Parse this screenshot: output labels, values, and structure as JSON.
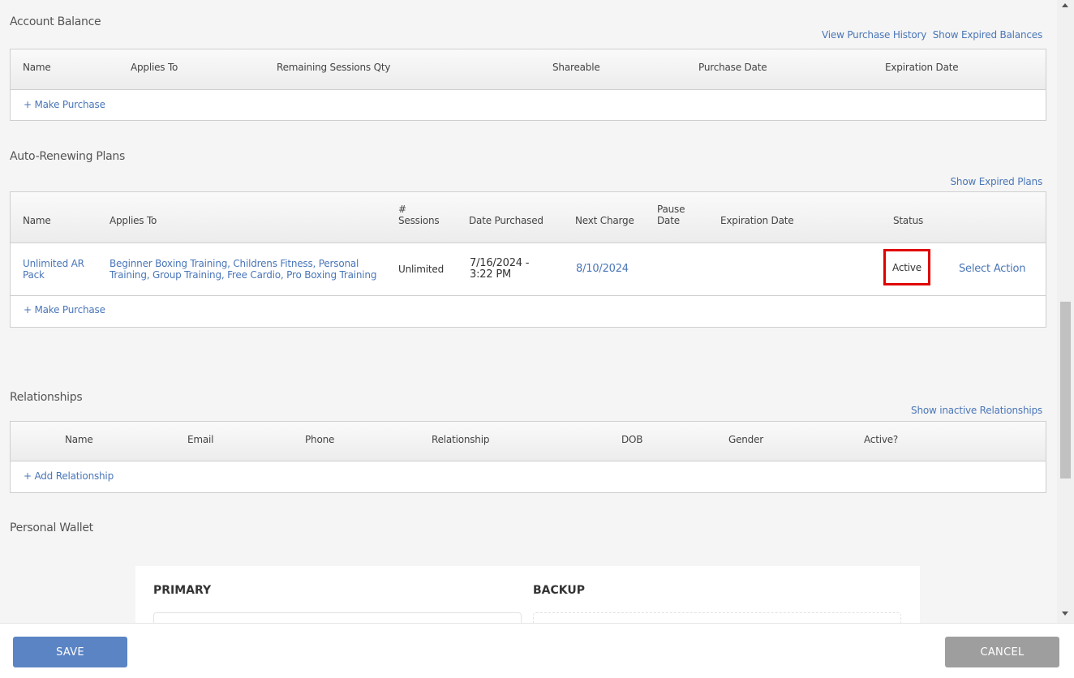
{
  "account_balance": {
    "title": "Account Balance",
    "links": [
      "View Purchase History",
      "Show Expired Balances"
    ],
    "columns": [
      "Name",
      "Applies To",
      "Remaining Sessions Qty",
      "Shareable",
      "Purchase Date",
      "Expiration Date"
    ],
    "make_purchase": "+ Make Purchase"
  },
  "auto_renewing": {
    "title": "Auto-Renewing Plans",
    "link": "Show Expired Plans",
    "columns": [
      "Name",
      "Applies To",
      "#\nSessions",
      "Date Purchased",
      "Next Charge",
      "Pause\nDate",
      "Expiration Date",
      "Status"
    ],
    "row": {
      "name": "Unlimited AR Pack",
      "applies_to": "Beginner Boxing Training, Childrens Fitness, Personal Training, Group Training, Free Cardio, Pro Boxing Training",
      "sessions": "Unlimited",
      "date_purchased": "7/16/2024 - 3:22 PM",
      "next_charge": "8/10/2024",
      "status": "Active",
      "action": "Select Action"
    },
    "make_purchase": "+ Make Purchase"
  },
  "relationships": {
    "title": "Relationships",
    "link": "Show inactive Relationships",
    "columns": [
      "Name",
      "Email",
      "Phone",
      "Relationship",
      "DOB",
      "Gender",
      "Active?"
    ],
    "add": "+ Add Relationship"
  },
  "wallet": {
    "title": "Personal Wallet",
    "primary": "PRIMARY",
    "backup": "BACKUP"
  },
  "footer": {
    "save": "SAVE",
    "cancel": "CANCEL"
  },
  "colors": {
    "link": "#4a76b8",
    "save": "#5b84c4",
    "cancel": "#9e9e9e",
    "highlight": "#e00000"
  }
}
